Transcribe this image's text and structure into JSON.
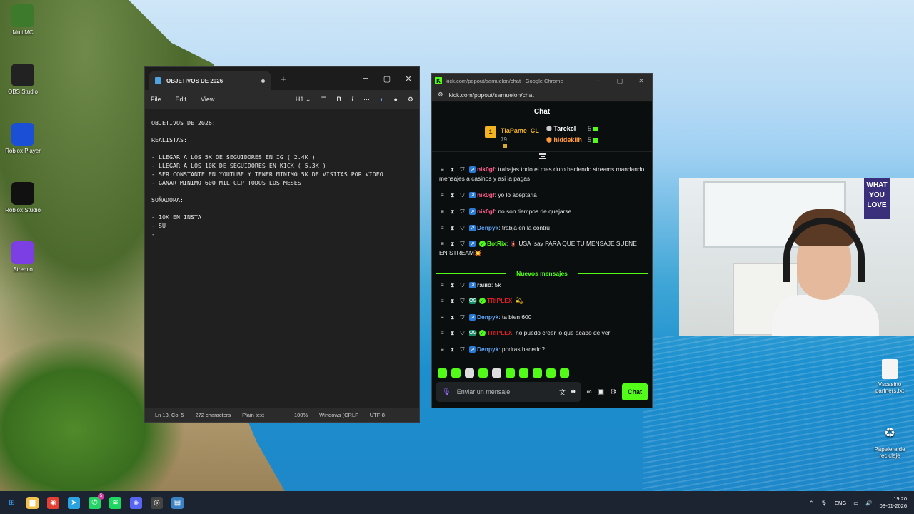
{
  "desktop": {
    "icons_left": [
      {
        "label": "MultiMC",
        "icon": "multimc-icon",
        "color": "#3d7a2b"
      },
      {
        "label": "OBS Studio",
        "icon": "obs-icon",
        "color": "#222"
      },
      {
        "label": "Roblox Player",
        "icon": "roblox-icon",
        "color": "#1a4fd6"
      },
      {
        "label": "Roblox Studio",
        "icon": "roblox-studio-icon",
        "color": "#111"
      },
      {
        "label": "Stremio",
        "icon": "stremio-icon",
        "color": "#7b3fe4"
      }
    ],
    "icons_right": [
      {
        "label": "Vscasino partners.txt",
        "icon": "text-file-icon"
      },
      {
        "label": "Papelera de reciclaje",
        "icon": "recycle-bin-icon"
      }
    ]
  },
  "notepad": {
    "tab_title": "OBJETIVOS DE 2026",
    "menu": {
      "file": "File",
      "edit": "Edit",
      "view": "View",
      "heading": "H1"
    },
    "content": "OBJETIVOS DE 2026:\n\nREALISTAS:\n\n- LLEGAR A LOS 5K DE SEGUIDORES EN IG ( 2.4K )\n- LLEGAR A LOS 10K DE SEGUIDORES EN KICK ( 5.3K )\n- SER CONSTANTE EN YOUTUBE Y TENER MINIMO 5K DE VISITAS POR VIDEO\n- GANAR MINIMO 600 MIL CLP TODOS LOS MESES\n\nSOÑADORA:\n\n- 10K EN INSTA\n- SU\n-",
    "status": {
      "position": "Ln 13, Col 5",
      "chars": "272 characters",
      "format": "Plain text",
      "zoom": "100%",
      "line_ending": "Windows (CRLF",
      "encoding": "UTF-8"
    }
  },
  "chrome": {
    "window_title": "kick.com/popout/samuelon/chat - Google Chrome",
    "url": "kick.com/popout/samuelon/chat",
    "accent": "#53fc18",
    "chat_title": "Chat",
    "leaderboard": {
      "first": {
        "rank": "1",
        "name": "TiaPame_CL",
        "points": "79"
      },
      "others": [
        {
          "name": "Tarekcl",
          "points": "5",
          "color": "#ffffff"
        },
        {
          "name": "hiddekiih",
          "points": "5",
          "color": "#ff9a3c"
        }
      ]
    },
    "messages_before": [
      {
        "user": "nik0gf",
        "color": "#ff5c8a",
        "text": "trabajas todo el mes duro haciendo streams mandando mensajes a casinos y asi la pagas"
      },
      {
        "user": "nik0gf",
        "color": "#ff5c8a",
        "text": "yo lo aceptaria"
      },
      {
        "user": "nik0gf",
        "color": "#ff5c8a",
        "text": "no son tiempos de quejarse"
      },
      {
        "user": "Denpyk",
        "color": "#5fa8ff",
        "text": "trabja en la contru"
      },
      {
        "user": "BotRix",
        "color": "#53fc18",
        "text": "🧯 USA !say PARA QUE TU MENSAJE SUENE EN STREAM💥"
      }
    ],
    "new_messages_label": "Nuevos mensajes",
    "messages_after": [
      {
        "user": "raiiio",
        "color": "#dddddd",
        "text": "5k"
      },
      {
        "user": "TRIPLEX",
        "color": "#e0202a",
        "text": "💫"
      },
      {
        "user": "Denpyk",
        "color": "#5fa8ff",
        "text": "ta bien 600"
      },
      {
        "user": "TRIPLEX",
        "color": "#e0202a",
        "text": "no puedo creer lo que acabo de ver"
      },
      {
        "user": "Denpyk",
        "color": "#5fa8ff",
        "text": "podras hacerlo?"
      }
    ],
    "input_placeholder": "Enviar un mensaje",
    "send_label": "Chat"
  },
  "webcam": {
    "poster_text": "WHAT YOU LOVE"
  },
  "taskbar": {
    "apps": [
      {
        "icon": "windows-start-icon",
        "color": "#3ba6ff"
      },
      {
        "icon": "file-explorer-icon",
        "color": "#f2c14e"
      },
      {
        "icon": "chrome-icon",
        "color": "#e44134"
      },
      {
        "icon": "telegram-icon",
        "color": "#2aa3e0"
      },
      {
        "icon": "whatsapp-icon",
        "color": "#25d366"
      },
      {
        "icon": "spotify-icon",
        "color": "#1ed760"
      },
      {
        "icon": "discord-icon",
        "color": "#5865f2"
      },
      {
        "icon": "obs-icon",
        "color": "#444"
      },
      {
        "icon": "notepad-icon",
        "color": "#3b82c4"
      }
    ],
    "whatsapp_badge": "5",
    "lang": "ENG",
    "time": "19:20",
    "date": "08-01-2026"
  }
}
